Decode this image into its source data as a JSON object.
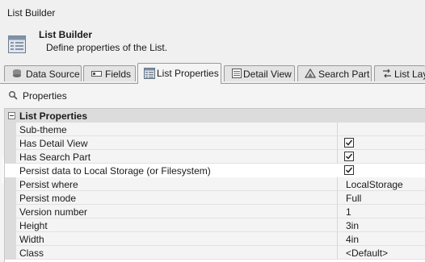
{
  "window": {
    "title": "List Builder"
  },
  "header": {
    "title": "List Builder",
    "subtitle": "Define properties of the List."
  },
  "tabs": [
    {
      "label": "Data Source",
      "icon": "database-icon"
    },
    {
      "label": "Fields",
      "icon": "fields-icon"
    },
    {
      "label": "List Properties",
      "icon": "list-properties-icon",
      "active": true
    },
    {
      "label": "Detail View",
      "icon": "detail-view-icon"
    },
    {
      "label": "Search Part",
      "icon": "search-part-icon"
    },
    {
      "label": "List Layo",
      "icon": "list-layout-icon"
    }
  ],
  "properties_bar": {
    "label": "Properties",
    "icon": "properties-icon"
  },
  "grid": {
    "category": "List Properties",
    "rows": [
      {
        "name": "Sub-theme",
        "value": ""
      },
      {
        "name": "Has Detail View",
        "value": "",
        "checked": true
      },
      {
        "name": "Has Search Part",
        "value": "",
        "checked": true
      },
      {
        "name": "Persist data to Local Storage (or Filesystem)",
        "value": "",
        "checked": true
      },
      {
        "name": "Persist where",
        "value": "LocalStorage"
      },
      {
        "name": "Persist mode",
        "value": "Full"
      },
      {
        "name": "Version number",
        "value": "1"
      },
      {
        "name": "Height",
        "value": "3in"
      },
      {
        "name": "Width",
        "value": "4in"
      },
      {
        "name": "Class",
        "value": "<Default>"
      }
    ]
  }
}
